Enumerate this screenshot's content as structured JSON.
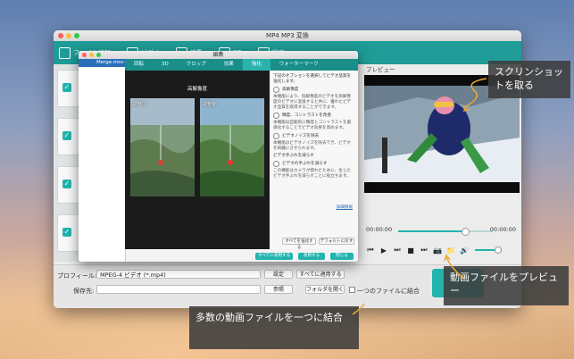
{
  "window": {
    "title": "MP4 MP3 変換"
  },
  "toolbar": {
    "buttons": [
      "ファイル追加",
      "ビデオ",
      "編集",
      "3D",
      "設定"
    ]
  },
  "edit_dialog": {
    "title": "編集",
    "file_name": "Merge.mov",
    "tabs": [
      "回転",
      "3D",
      "クロップ",
      "効果",
      "強化",
      "ウォーターマーク"
    ],
    "active_tab": "強化",
    "compare_title": "高解像度",
    "before_label": "調整前",
    "after_label": "調整後",
    "intro": "下記のオプションを選択してビデオ品質を強化します。",
    "options": [
      {
        "label": "高解像度",
        "desc": "本機能により、低解像度のビデオを高解像度のビデオに変換すると共に、優れたビデオ品質を取得することができます。"
      },
      {
        "label": "輝度、コントラストを改善",
        "desc": "本機能は自動的に輝度とコントラストを最適化することでビデオ効果を高めます。"
      },
      {
        "label": "ビデオノイズを除去",
        "desc": "本機能はビデオノイズを除去でき、ビデオを綺麗にさせられます。"
      },
      {
        "label": "ビデオの手ぶれを減らす",
        "desc": "この機能はカメラが揺れたために、生じたビデオ手ぶれを減らすことに役立ちます。"
      }
    ],
    "section_shake": "ビデオ手ぶれを減らす",
    "more_link": "詳細情報",
    "apply_all": "すべてを強化する",
    "reset": "デフォルトに戻す",
    "footer": {
      "apply_all": "すべてに適用する",
      "apply": "適用する",
      "close": "閉じる"
    }
  },
  "preview": {
    "header": "プレビュー",
    "time_current": "00:00:00",
    "time_total": "00:00:00",
    "seek_fraction": 0.7,
    "controls": [
      "skip-back-icon",
      "play-icon",
      "step-forward-icon",
      "stop-icon",
      "skip-forward-icon",
      "camera-icon",
      "folder-icon",
      "volume-icon"
    ]
  },
  "bottom": {
    "profile_label": "プロフィール:",
    "profile_value": "MPEG-4 ビデオ (*.mp4)",
    "settings_button": "設定",
    "apply_all_button": "すべてに適用する",
    "save_label": "保存先:",
    "save_value": "",
    "browse_button": "参照",
    "open_folder_button": "フォルダを開く",
    "merge_label": "一つのファイルに結合"
  },
  "callouts": {
    "screenshot": "スクリンショットを取る",
    "preview": "動画ファイルをプレビュー",
    "merge": "多数の動画ファイルを一つに結合"
  },
  "colors": {
    "accent": "#22b3ad",
    "toolbar": "#1f9c97",
    "callout_bg": "#3c3c3c",
    "arrow": "#f0a830"
  }
}
